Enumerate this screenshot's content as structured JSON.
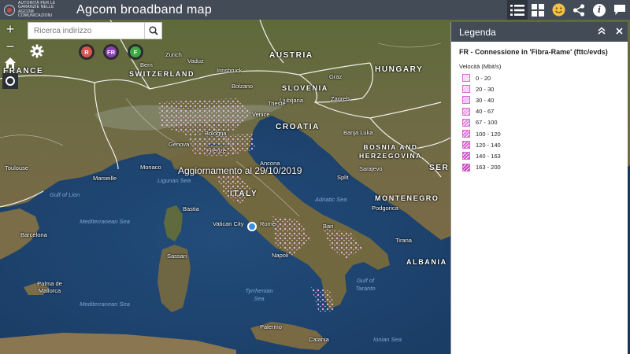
{
  "header": {
    "logo_lines": [
      "AUTORITÀ PER LE",
      "GARANZIE NELLE",
      "COMUNICAZIONI"
    ],
    "logo_abbr": "AGCOM",
    "title": "Agcom broadband map",
    "tools": [
      {
        "name": "list-icon",
        "glyph": "☰"
      },
      {
        "name": "grid-icon",
        "glyph": "▦"
      },
      {
        "name": "smiley-icon",
        "glyph": "☺"
      },
      {
        "name": "share-icon",
        "glyph": "⋖"
      },
      {
        "name": "info-icon",
        "glyph": "i"
      },
      {
        "name": "comment-icon",
        "glyph": "▭"
      }
    ]
  },
  "map": {
    "search_placeholder": "Ricerca indirizzo",
    "zoom_in": "+",
    "zoom_out": "−",
    "layers": [
      {
        "label": "R",
        "color": "#d9534f"
      },
      {
        "label": "FR",
        "color": "#8e3fb3"
      },
      {
        "label": "F",
        "color": "#3aa845"
      }
    ],
    "update_note": "Aggiornamento al 29/10/2019",
    "countries": [
      "FRANCE",
      "SWITZERLAND",
      "AUSTRIA",
      "HUNGARY",
      "SLOVENIA",
      "CROATIA",
      "BOSNIA AND HERZEGOVINA",
      "ITALY",
      "MONTENEGRO",
      "ALBANIA",
      "SER"
    ],
    "cities": [
      "Zurich",
      "Vaduz",
      "Bern",
      "Bolzano",
      "Ljubljana",
      "Zagreb",
      "Monaco",
      "Venice",
      "Marseille",
      "Toulouse",
      "Barcelona",
      "Sarajevo",
      "Split",
      "Banja Luka",
      "Tirana",
      "Podgorica",
      "Napoli",
      "Vatican City",
      "Rome",
      "Bastia",
      "Sassari",
      "Palma de Mallorca",
      "Trieste",
      "Graz",
      "Innsbruck",
      "Bologna",
      "Genova",
      "Firenze",
      "Ancona",
      "Bari",
      "Palermo",
      "Catania"
    ],
    "seas": [
      "Ligurian Sea",
      "Gulf of Lion",
      "Mediterranean Sea",
      "Mediterranean Sea",
      "Tyrrhenian Sea",
      "Adriatic Sea",
      "Gulf of Taranto",
      "Ionian Sea"
    ]
  },
  "legend": {
    "title": "Legenda",
    "layer_title": "FR - Connessione in 'Fibra-Rame' (fttc/evds)",
    "field_label": "Velocità (Mbit/s)",
    "classes": [
      {
        "label": "0 - 20",
        "color": "#f7d3f3"
      },
      {
        "label": "20 - 30",
        "color": "#f4c3ef"
      },
      {
        "label": "30 - 40",
        "color": "#f0b2ea"
      },
      {
        "label": "40 - 67",
        "color": "#eca0e5"
      },
      {
        "label": "67 - 100",
        "color": "#e78ee0"
      },
      {
        "label": "100 - 120",
        "color": "#e27ad9"
      },
      {
        "label": "120 - 140",
        "color": "#dc66d1"
      },
      {
        "label": "140 - 163",
        "color": "#d452c8"
      },
      {
        "label": "163 - 200",
        "color": "#c83cbc"
      }
    ]
  }
}
